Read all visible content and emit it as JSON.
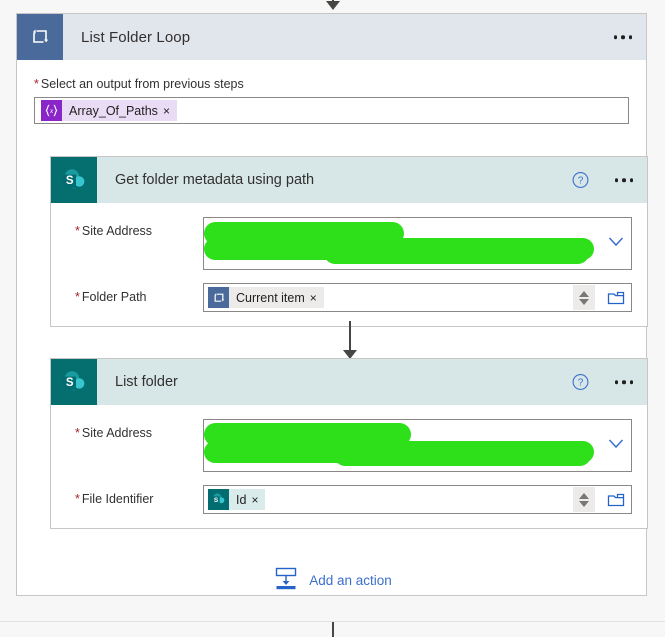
{
  "colors": {
    "loop_accent": "#4a6a9c",
    "loop_header_bg": "#e1e5ec",
    "sharepoint_accent": "#056e6e",
    "sharepoint_header_bg": "#d7e6e6",
    "redaction": "#2ee019",
    "link": "#3a6fce",
    "required_star": "#a4262c",
    "token_purple_bg": "#ebdcf6",
    "token_purple_icon": "#8a25c9",
    "token_gray_bg": "#edebe9",
    "token_teal_bg": "#d9ebeb"
  },
  "loop_card": {
    "icon": "loop-icon",
    "title": "List Folder Loop",
    "overflow_menu": "...",
    "output_field": {
      "required_marker": "*",
      "label": "Select an output from previous steps",
      "token": {
        "icon": "expression-braces-icon",
        "label": "Array_Of_Paths",
        "remove": "×"
      }
    }
  },
  "actions": [
    {
      "icon": "sharepoint-icon",
      "title": "Get folder metadata using path",
      "help": "?",
      "overflow_menu": "...",
      "fields": [
        {
          "required_marker": "*",
          "label": "Site Address",
          "type": "combobox-redacted",
          "value": "",
          "chevron": "chevron-down-icon"
        },
        {
          "required_marker": "*",
          "label": "Folder Path",
          "type": "token-input",
          "token": {
            "icon": "loop-icon",
            "label": "Current item",
            "remove": "×",
            "style": "gray"
          },
          "spinner": "dynamic-content-spinner",
          "picker": "folder-picker-icon"
        }
      ]
    },
    {
      "icon": "sharepoint-icon",
      "title": "List folder",
      "help": "?",
      "overflow_menu": "...",
      "fields": [
        {
          "required_marker": "*",
          "label": "Site Address",
          "type": "combobox-redacted",
          "value": "",
          "chevron": "chevron-down-icon"
        },
        {
          "required_marker": "*",
          "label": "File Identifier",
          "type": "token-input",
          "token": {
            "icon": "sharepoint-icon",
            "label": "Id",
            "remove": "×",
            "style": "teal"
          },
          "spinner": "dynamic-content-spinner",
          "picker": "folder-picker-icon"
        }
      ]
    }
  ],
  "add_action": {
    "icon": "insert-action-icon",
    "label": "Add an action"
  }
}
